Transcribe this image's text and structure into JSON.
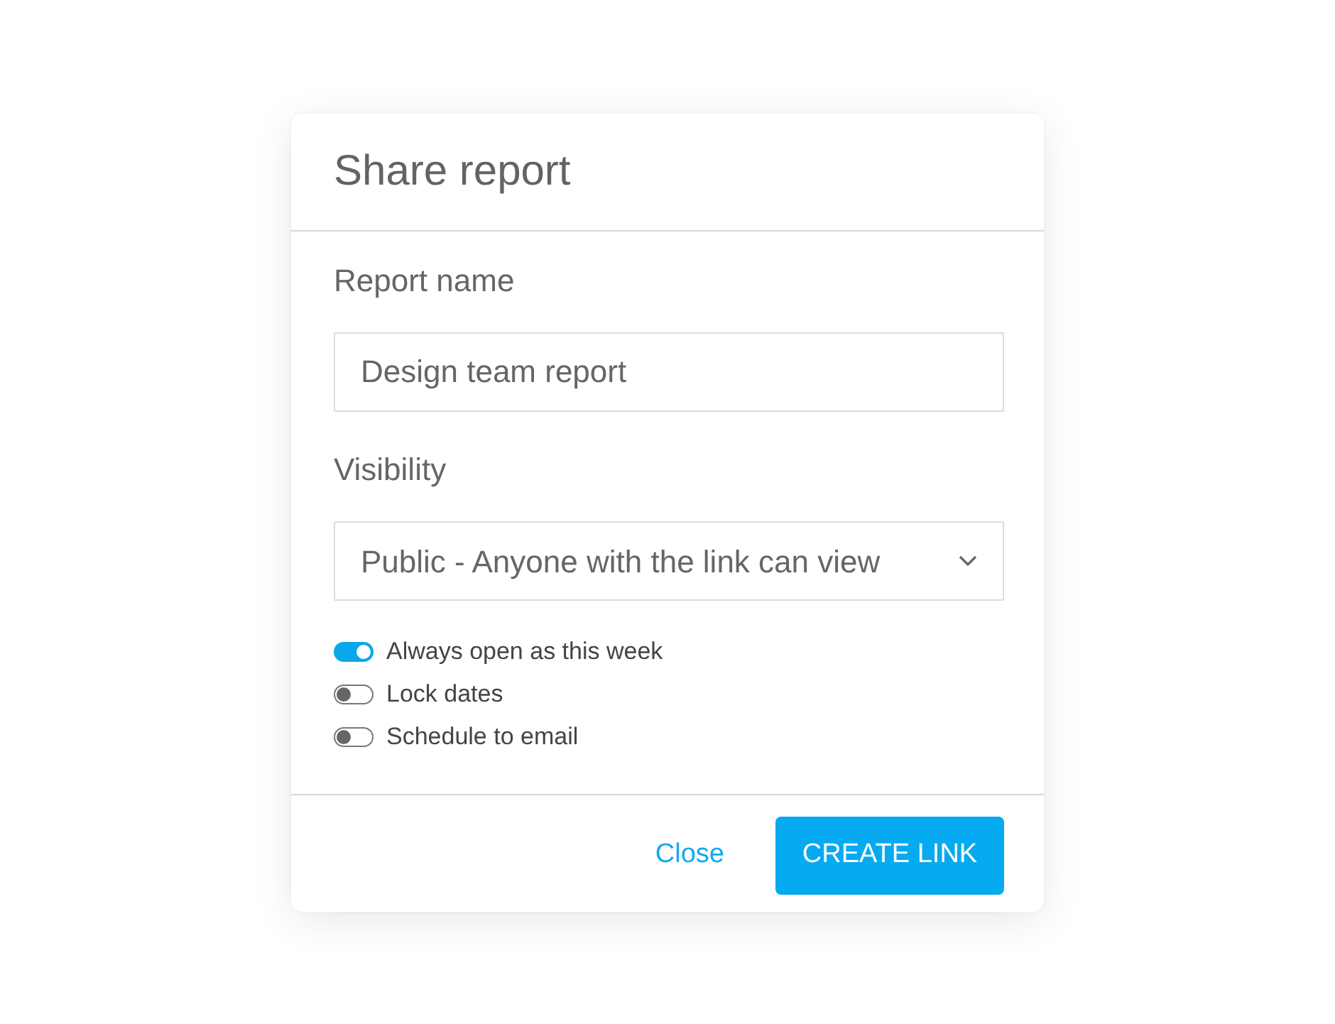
{
  "dialog": {
    "title": "Share report",
    "report_name": {
      "label": "Report name",
      "value": "Design team report"
    },
    "visibility": {
      "label": "Visibility",
      "value": "Public - Anyone with the link can view"
    },
    "toggles": [
      {
        "label": "Always open as this week",
        "on": true
      },
      {
        "label": "Lock dates",
        "on": false
      },
      {
        "label": "Schedule to email",
        "on": false
      }
    ],
    "buttons": [
      {
        "label": "Close",
        "kind": "link"
      },
      {
        "label": "CREATE LINK",
        "kind": "primary"
      }
    ]
  }
}
